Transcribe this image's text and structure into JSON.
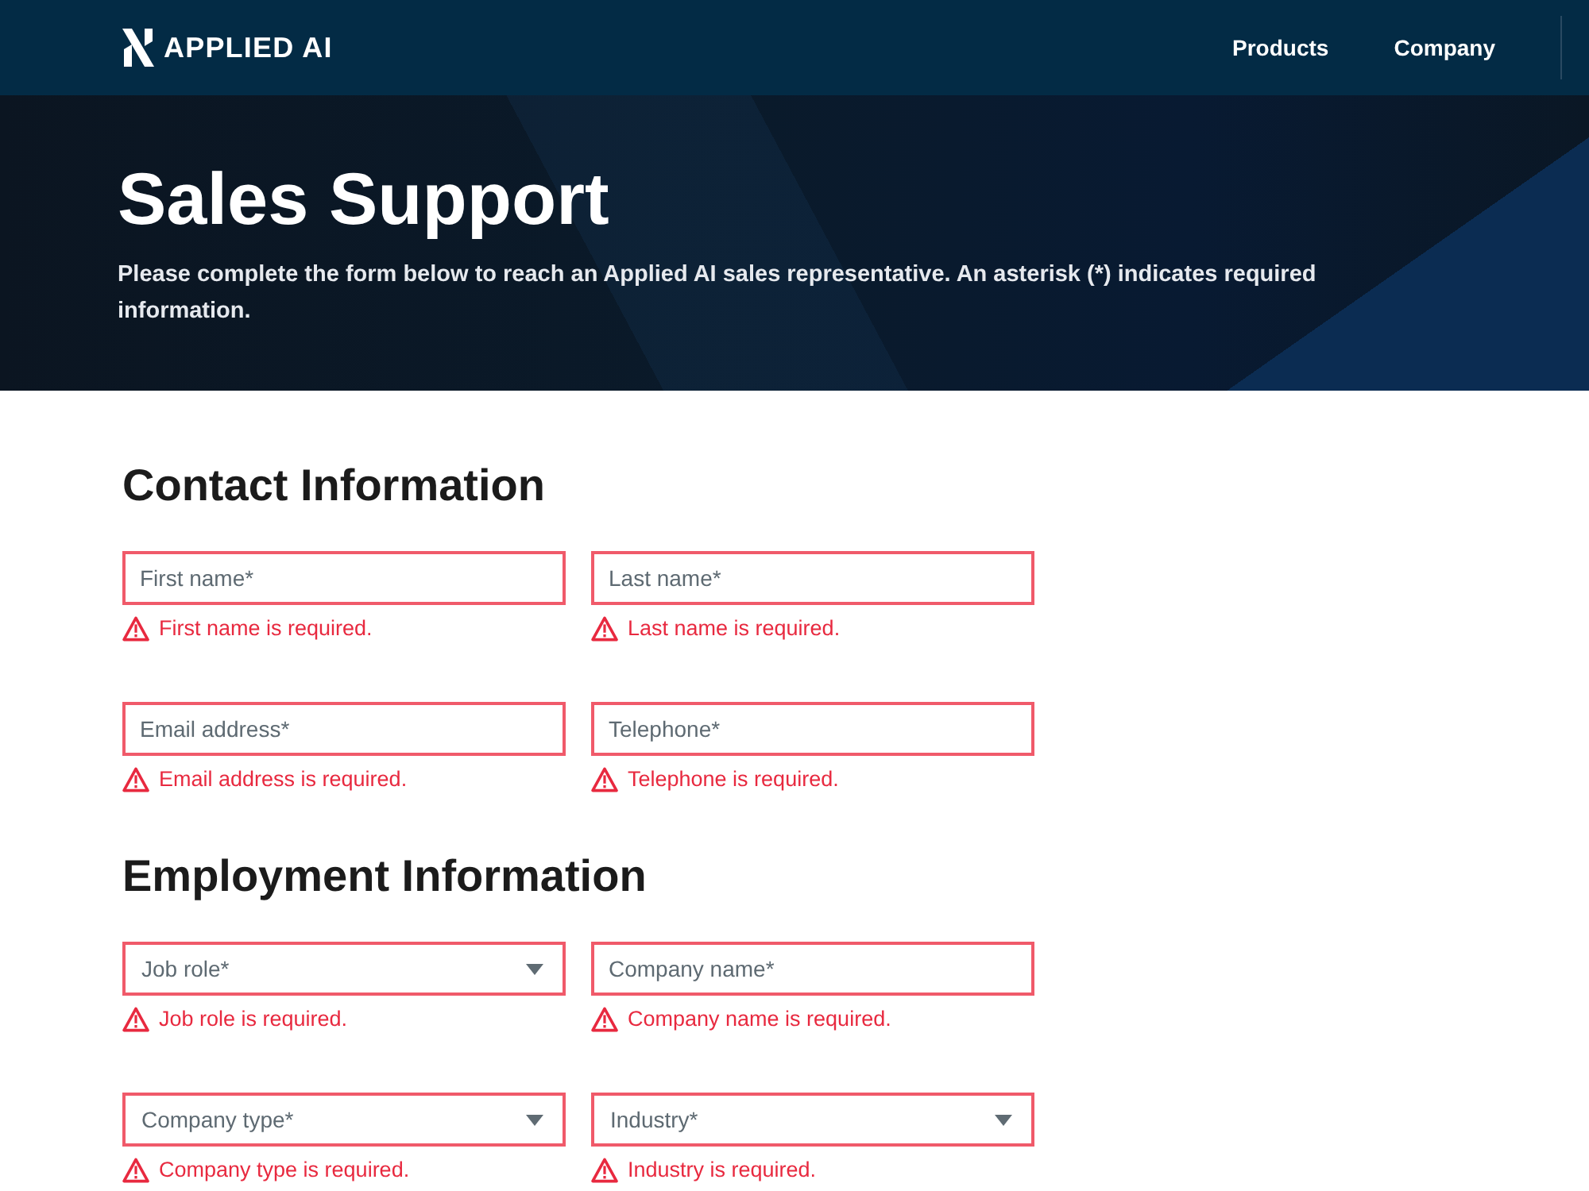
{
  "header": {
    "brand": "APPLIED AI",
    "nav": [
      {
        "label": "Products"
      },
      {
        "label": "Company"
      }
    ]
  },
  "hero": {
    "title": "Sales Support",
    "description": "Please complete the form below to reach an Applied AI sales representative. An asterisk (*) indicates required information."
  },
  "sections": [
    {
      "title": "Contact Information",
      "fields": [
        {
          "kind": "text",
          "placeholder": "First name*",
          "invalid": true,
          "error": "First name is required."
        },
        {
          "kind": "text",
          "placeholder": "Last name*",
          "invalid": true,
          "error": "Last name is required."
        },
        {
          "kind": "text",
          "placeholder": "Email address*",
          "invalid": true,
          "error": "Email address is required."
        },
        {
          "kind": "text",
          "placeholder": "Telephone*",
          "invalid": true,
          "error": "Telephone is required."
        }
      ]
    },
    {
      "title": "Employment Information",
      "fields": [
        {
          "kind": "select",
          "placeholder": "Job role*",
          "invalid": true,
          "error": "Job role is required."
        },
        {
          "kind": "text",
          "placeholder": "Company name*",
          "invalid": true,
          "error": "Company name is required."
        },
        {
          "kind": "select",
          "placeholder": "Company type*",
          "invalid": true,
          "error": "Company type is required."
        },
        {
          "kind": "select",
          "placeholder": "Industry*",
          "invalid": true,
          "error": "Industry is required."
        }
      ]
    }
  ]
}
